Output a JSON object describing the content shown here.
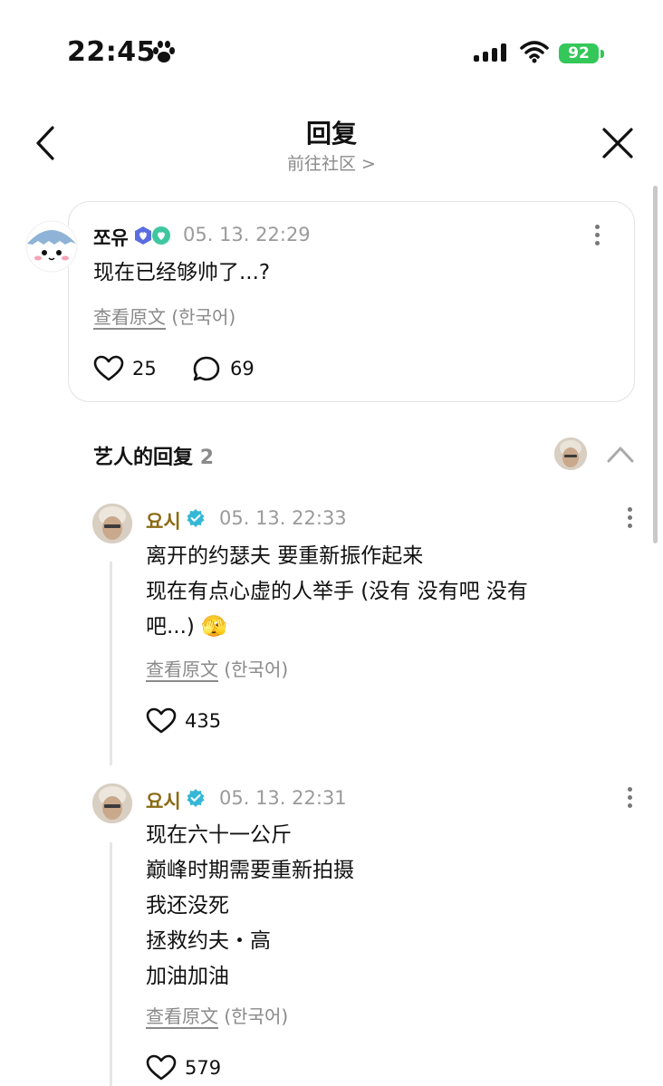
{
  "status": {
    "time": "22:45",
    "battery": "92"
  },
  "header": {
    "title": "回复",
    "subtitle": "前往社区 >"
  },
  "post": {
    "author": "쪼유",
    "date": "05. 13. 22:29",
    "text": "现在已经够帅了...?",
    "translate_link": "查看原文",
    "translate_lang": "(한국어)",
    "likes": "25",
    "comments": "69"
  },
  "artist_section": {
    "title": "艺人的回复",
    "count": "2"
  },
  "replies": [
    {
      "author": "요시",
      "date": "05. 13. 22:33",
      "lines": [
        "离开的约瑟夫 要重新振作起来",
        "现在有点心虚的人举手 (没有 没有吧 没有",
        "吧...) 🫣"
      ],
      "translate_link": "查看原文",
      "translate_lang": "(한국어)",
      "likes": "435"
    },
    {
      "author": "요시",
      "date": "05. 13. 22:31",
      "lines": [
        "现在六十一公斤",
        "巅峰时期需要重新拍摄",
        "我还没死",
        "拯救约夫・高",
        "加油加油"
      ],
      "translate_link": "查看原文",
      "translate_lang": "(한국어)",
      "likes": "579"
    }
  ],
  "colors": {
    "accent": "#34c759",
    "artist_name": "#8a6a14",
    "verified": "#35b7d6"
  }
}
